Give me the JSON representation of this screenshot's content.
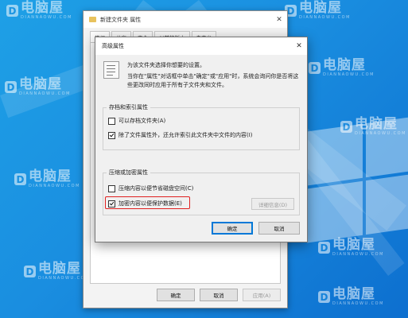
{
  "props_window": {
    "title": "新建文件夹 属性",
    "tabs": [
      "常规",
      "共享",
      "安全",
      "以前的版本",
      "自定义"
    ],
    "ok_label": "确定",
    "cancel_label": "取消",
    "apply_label": "应用(A)"
  },
  "advanced_dialog": {
    "title": "高级属性",
    "info_line1": "为该文件夹选择你想要的设置。",
    "info_line2": "当你在\"属性\"对话框中单击\"确定\"或\"应用\"时，系统会询问你是否将这些更改同时应用于所有子文件夹和文件。",
    "archive_group": {
      "legend": "存档和索引属性",
      "archive_label": "可以存档文件夹(A)",
      "archive_checked": false,
      "index_label": "除了文件属性外，还允许索引此文件夹中文件的内容(I)",
      "index_checked": true
    },
    "compress_group": {
      "legend": "压缩或加密属性",
      "compress_label": "压缩内容以便节省磁盘空间(C)",
      "compress_checked": false,
      "encrypt_label": "加密内容以便保护数据(E)",
      "encrypt_checked": true,
      "details_label": "详细信息(D)"
    },
    "ok_label": "确定",
    "cancel_label": "取消"
  },
  "watermark": {
    "brand": "电脑屋",
    "brand_en": "DIANNAOWU.COM",
    "logo_letter": "D"
  },
  "colors": {
    "desktop_bg": "#1a8ee0",
    "highlight": "#e02020",
    "accent": "#0078d7"
  }
}
